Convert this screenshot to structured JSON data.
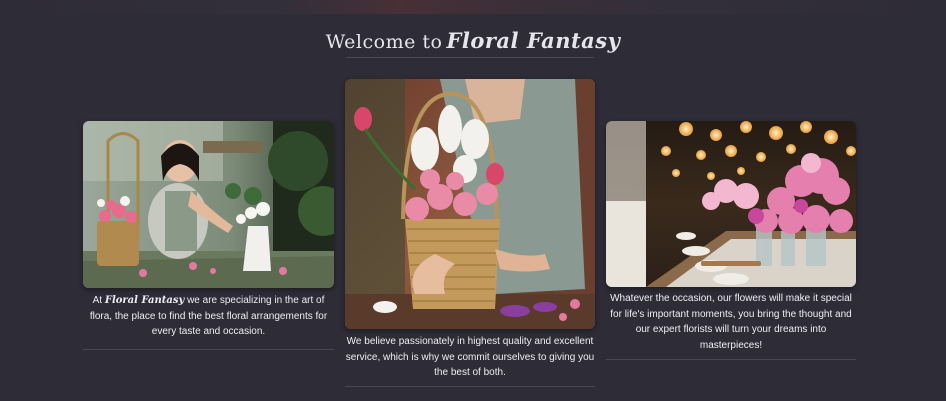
{
  "heading": {
    "prefix": "Welcome to",
    "brand": "Floral Fantasy"
  },
  "cards": [
    {
      "image_alt": "Smiling florist arranging flowers at a workbench",
      "caption_prefix": "At",
      "caption_brand": "Floral Fantasy",
      "caption_text": "we are specializing in the art of flora, the place to find the best floral arrangements for every taste and occasion."
    },
    {
      "image_alt": "Hands holding a wicker basket of pink roses and white lilies",
      "caption_text": "We believe passionately in highest quality and excellent service, which is why we commit ourselves to giving you the best of both."
    },
    {
      "image_alt": "Pink hydrangea centerpieces on an event table with string lights",
      "caption_text": "Whatever the occasion, our flowers will make it special for life's important moments, you bring the thought and our expert florists will turn your dreams into masterpieces!"
    }
  ],
  "colors": {
    "background": "#2e2c37",
    "text": "#eeedf2",
    "rule": "#4a4756"
  }
}
